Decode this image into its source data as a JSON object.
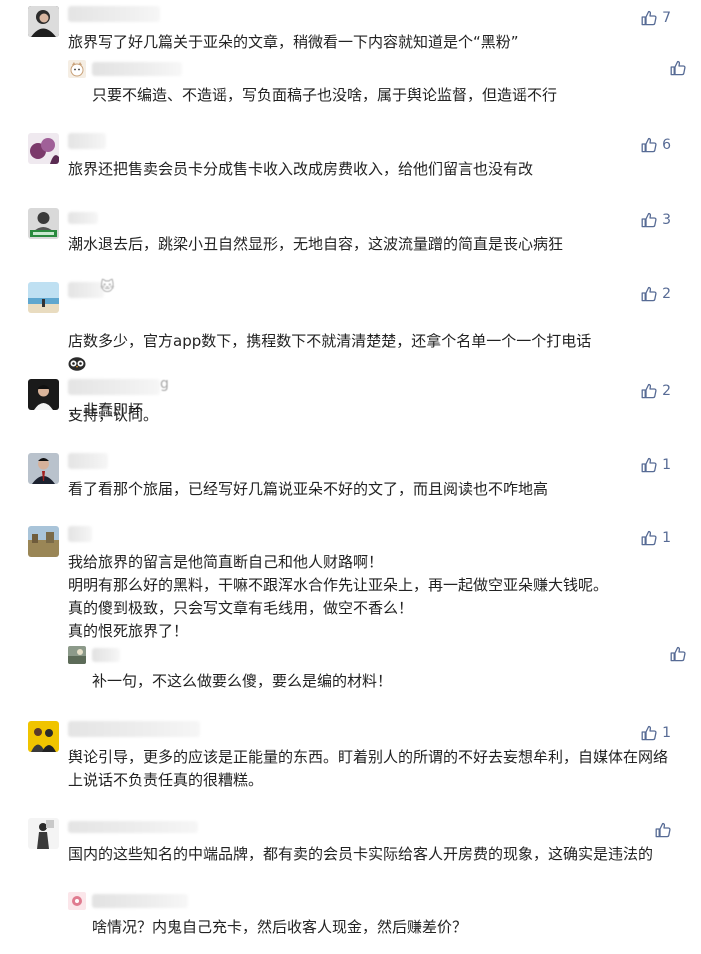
{
  "comments": [
    {
      "id": "c1",
      "text": "旅界写了好几篇关于亚朵的文章，稍微看一下内容就知道是个“黑粉”",
      "likes": "7",
      "avatar_icon": "woman-portrait-avatar",
      "reply": {
        "text": "只要不编造、不造谣，写负面稿子也没啥，属于舆论监督，但造谣不行",
        "likes": "",
        "avatar_icon": "cat-face-avatar"
      }
    },
    {
      "id": "c2",
      "text": "旅界还把售卖会员卡分成售卡收入改成房费收入，给他们留言也没有改",
      "likes": "6",
      "avatar_icon": "purple-flower-avatar"
    },
    {
      "id": "c3",
      "text": "潮水退去后，跳梁小丑自然显形，无地自容，这波流量蹭的简直是丧心病狂",
      "likes": "3",
      "avatar_icon": "green-badge-avatar"
    },
    {
      "id": "c4",
      "text_line1": "店数多少，官方app数下，携程数下不就清清楚楚，还拿个名单一个一个打电话",
      "text_line2": "，非蠢即坏",
      "likes": "2",
      "avatar_icon": "beach-avatar",
      "nick_tail": "🐱"
    },
    {
      "id": "c5",
      "text": "支持，认同。",
      "likes": "2",
      "avatar_icon": "man-portrait-avatar",
      "nick_tail": "g"
    },
    {
      "id": "c6",
      "text": "看了看那个旅届，已经写好几篇说亚朵不好的文了，而且阅读也不咋地高",
      "likes": "1",
      "avatar_icon": "businessman-avatar"
    },
    {
      "id": "c7",
      "text": "我给旅界的留言是他简直断自己和他人财路啊！\n明明有那么好的黑料，干嘛不跟浑水合作先让亚朵上，再一起做空亚朵赚大钱呢。\n真的傻到极致，只会写文章有毛线用，做空不香么！\n真的恨死旅界了！",
      "likes": "1",
      "avatar_icon": "landscape-avatar",
      "reply": {
        "text": "补一句，不这么做要么傻，要么是编的材料！",
        "likes": "",
        "avatar_icon": "photo-avatar"
      }
    },
    {
      "id": "c8",
      "text": "舆论引导，更多的应该是正能量的东西。盯着别人的所谓的不好去妄想牟利，自媒体在网络上说话不负责任真的很糟糕。",
      "likes": "1",
      "avatar_icon": "family-avatar"
    },
    {
      "id": "c9",
      "text": "国内的这些知名的中端品牌，都有卖的会员卡实际给客人开房费的现象，这确实是违法的",
      "likes": "",
      "avatar_icon": "figure-avatar",
      "reply": {
        "text": "啥情况？内鬼自己充卡，然后收客人现金，然后赚差价？",
        "likes": "",
        "avatar_icon": "pink-avatar"
      }
    }
  ],
  "colors": {
    "like": "#576b95",
    "text": "#222222",
    "background": "#ffffff"
  }
}
